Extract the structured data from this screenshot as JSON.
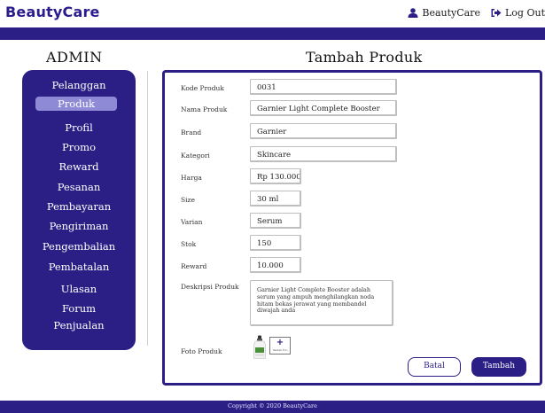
{
  "header": {
    "brand": "BeautyCare",
    "user_label": "BeautyCare",
    "logout_label": "Log Out",
    "accent": "#2b1f86"
  },
  "sidebar": {
    "title": "ADMIN",
    "items": [
      {
        "label": "Pelanggan",
        "active": false
      },
      {
        "label": "Produk",
        "active": true
      },
      {
        "label": "Profil",
        "active": false
      },
      {
        "label": "Promo",
        "active": false
      },
      {
        "label": "Reward",
        "active": false
      },
      {
        "label": "Pesanan",
        "active": false
      },
      {
        "label": "Pembayaran",
        "active": false
      },
      {
        "label": "Pengiriman",
        "active": false
      },
      {
        "label": "Pengembalian",
        "active": false
      },
      {
        "label": "Pembatalan",
        "active": false
      },
      {
        "label": "Ulasan",
        "active": false
      },
      {
        "label": "Forum",
        "active": false
      },
      {
        "label": "Penjualan",
        "active": false
      }
    ]
  },
  "main": {
    "title": "Tambah Produk",
    "form": {
      "kode_produk": {
        "label": "Kode Produk",
        "value": "0031"
      },
      "nama_produk": {
        "label": "Nama Produk",
        "value": "Garnier Light Complete Booster"
      },
      "brand": {
        "label": "Brand",
        "value": "Garnier"
      },
      "kategori": {
        "label": "Kategori",
        "value": "Skincare"
      },
      "harga": {
        "label": "Harga",
        "value": "Rp 130.000"
      },
      "size": {
        "label": "Size",
        "value": "30 ml"
      },
      "varian": {
        "label": "Varian",
        "value": "Serum"
      },
      "stok": {
        "label": "Stok",
        "value": "150"
      },
      "reward": {
        "label": "Reward",
        "value": "10.000"
      },
      "deskripsi": {
        "label": "Deskripsi Produk",
        "value": "Garnier Light Complete Booster adalah serum yang ampuh menghilangkan noda hitam bekas jerawat yang membandel diwajah anda"
      },
      "foto": {
        "label": "Foto Produk",
        "upload_caption": "Tambah Foto"
      }
    },
    "buttons": {
      "cancel": "Batal",
      "submit": "Tambah"
    }
  },
  "footer": {
    "text": "Copyright © 2020 BeautyCare"
  }
}
